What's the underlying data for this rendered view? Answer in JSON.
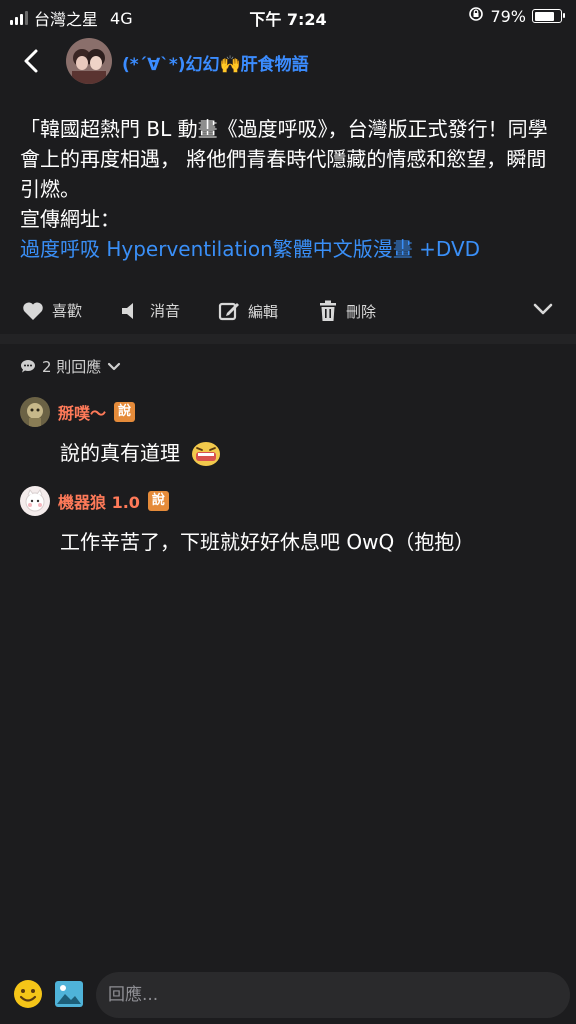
{
  "status_bar": {
    "carrier": "台灣之星",
    "network": "4G",
    "time": "下午 7:24",
    "battery": "79%",
    "battery_level": 0.79
  },
  "header": {
    "author_name": "(*´∀`*)幻幻🙌肝食物語"
  },
  "post": {
    "lines": [
      "「韓國超熱門 BL 動畫《過度呼吸》，台灣版正式發行！同學會上的再度相遇， 將他們青春時代隱藏的情感和慾望，瞬間引燃。",
      "宣傳網址："
    ],
    "link": "過度呼吸 Hyperventilation繁體中文版漫畫 +DVD"
  },
  "actions": {
    "like": "喜歡",
    "mute": "消音",
    "edit": "編輯",
    "delete": "刪除"
  },
  "replies": {
    "count_label": "2 則回應",
    "items": [
      {
        "name": "掰噗～",
        "badge": "說",
        "text": "說的真有道理"
      },
      {
        "name": "機器狼 1.0",
        "badge": "說",
        "text": "工作辛苦了，下班就好好休息吧 OwQ（抱抱）"
      }
    ]
  },
  "composer": {
    "placeholder": "回應..."
  },
  "colors": {
    "background": "#1c1c1e",
    "link": "#3a8ff7",
    "name_accent": "#ff7a59",
    "badge": "#e58b3a"
  }
}
